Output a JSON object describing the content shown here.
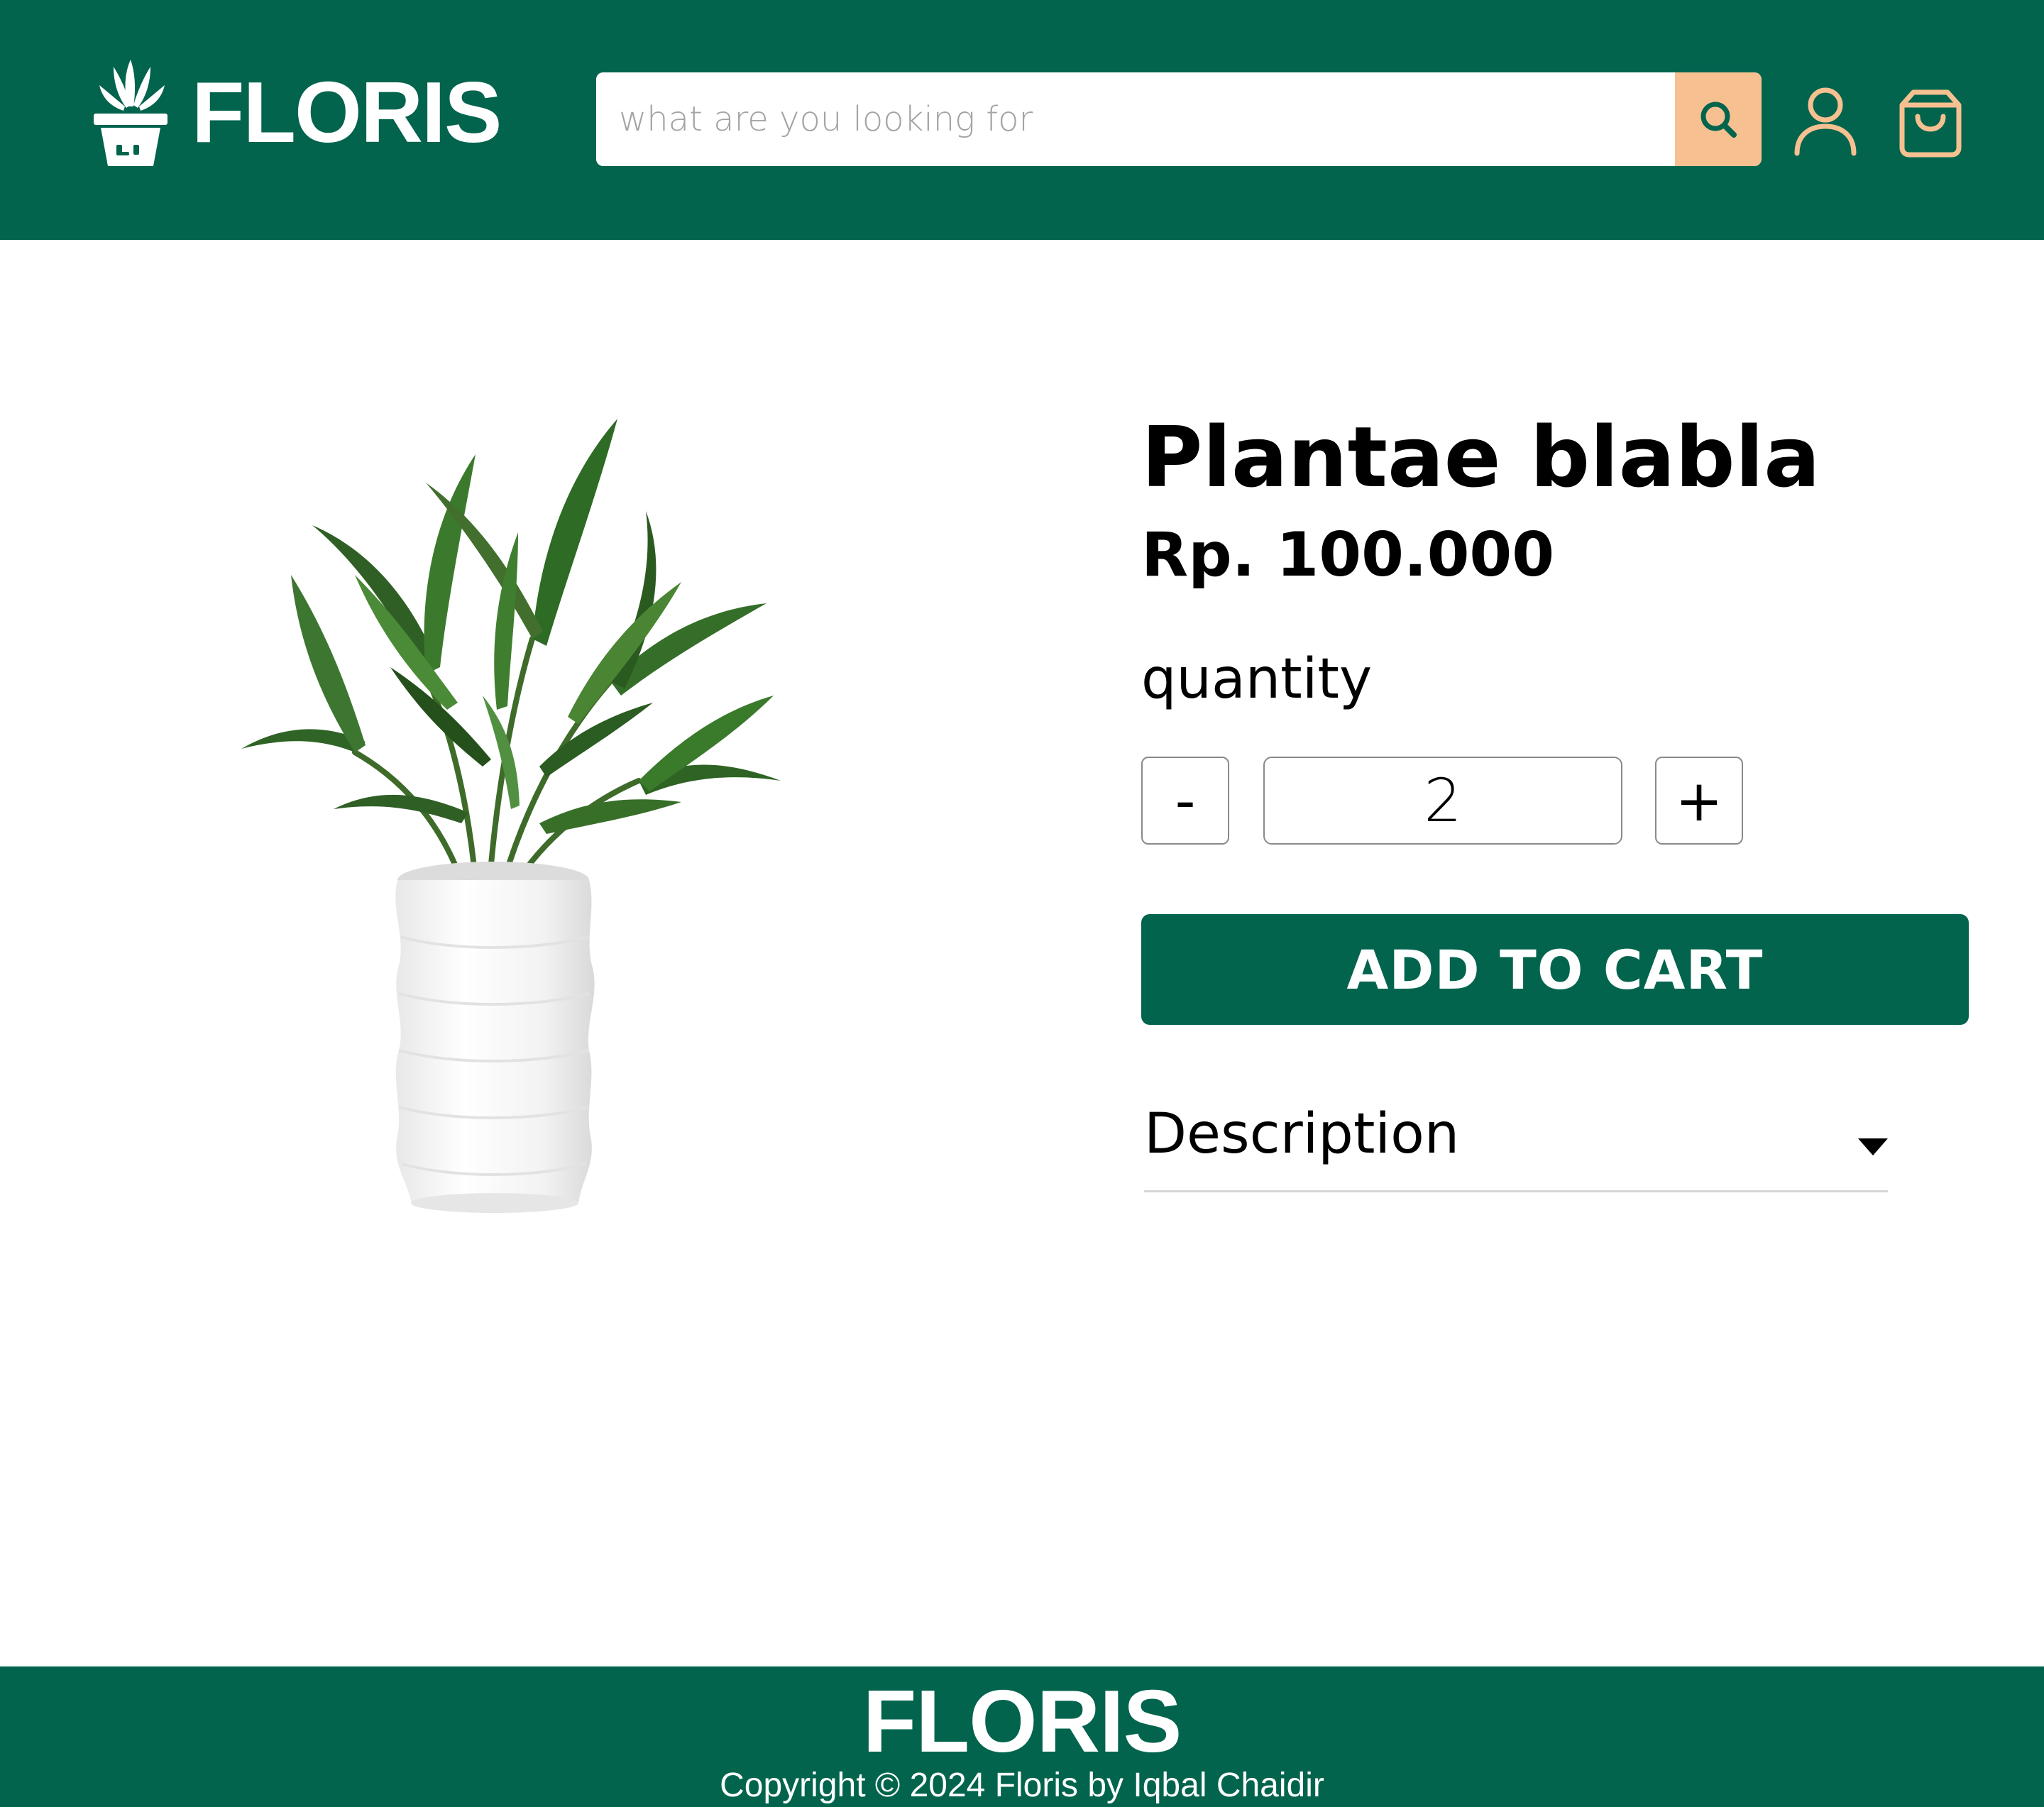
{
  "header": {
    "brand": "FLORIS",
    "search": {
      "placeholder": "what are you looking for",
      "value": ""
    },
    "icons": {
      "logo": "plant-pot-icon",
      "search": "search-icon",
      "account": "user-icon",
      "cart": "shopping-bag-icon"
    }
  },
  "product": {
    "title": "Plantae blabla",
    "price": "Rp. 100.000",
    "quantity_label": "quantity",
    "quantity_value": "2",
    "decrement_label": "-",
    "increment_label": "+",
    "add_to_cart_label": "ADD TO CART",
    "description_label": "Description",
    "image": "potted-plant-photo"
  },
  "footer": {
    "brand": "FLORIS",
    "copyright": "Copyright © 2024 Floris by Iqbal Chaidir"
  },
  "colors": {
    "primary": "#02644d",
    "accent": "#f7c091",
    "background": "#ffffff"
  }
}
